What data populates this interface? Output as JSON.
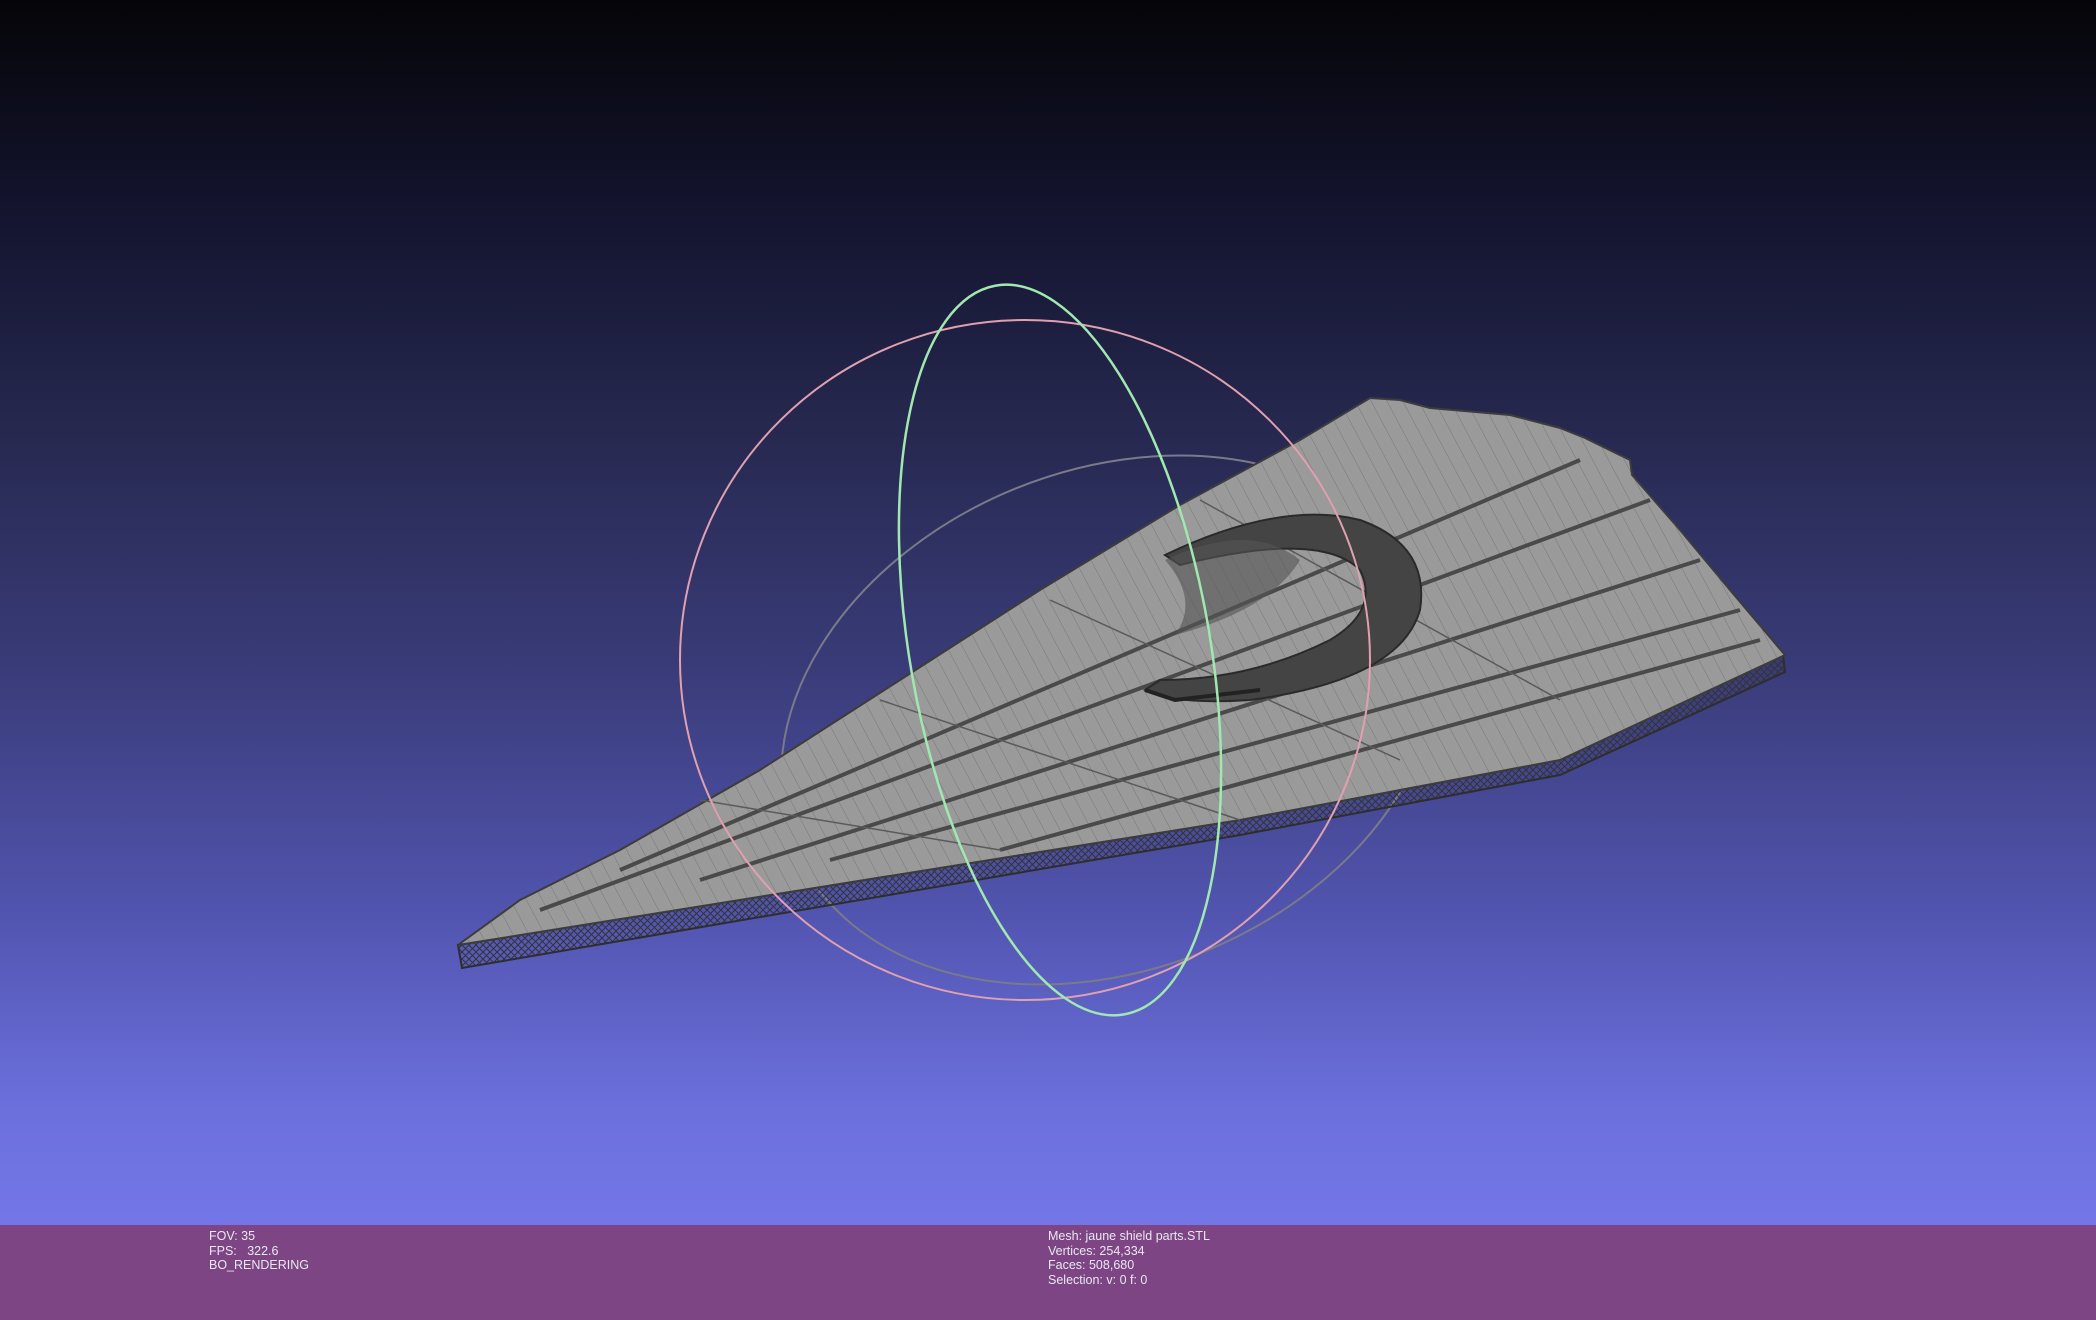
{
  "info_left": {
    "fov": "FOV: 35",
    "fps": "FPS:   322.6",
    "mode": "BO_RENDERING"
  },
  "info_right": {
    "mesh": "Mesh: jaune shield parts.STL",
    "vertices": "Vertices: 254,334",
    "faces": "Faces: 508,680",
    "selection": "Selection: v: 0 f: 0"
  },
  "colors": {
    "statusbar": "#7d4584",
    "mesh_fill": "#9a9a9a",
    "mesh_wire": "#3c3c3c",
    "trackball_x": "#e0a0b0",
    "trackball_y": "#a0e8b0",
    "trackball_z": "#8a8a9a"
  },
  "icons": [
    "trackball-gizmo",
    "mesh-wireframe"
  ]
}
